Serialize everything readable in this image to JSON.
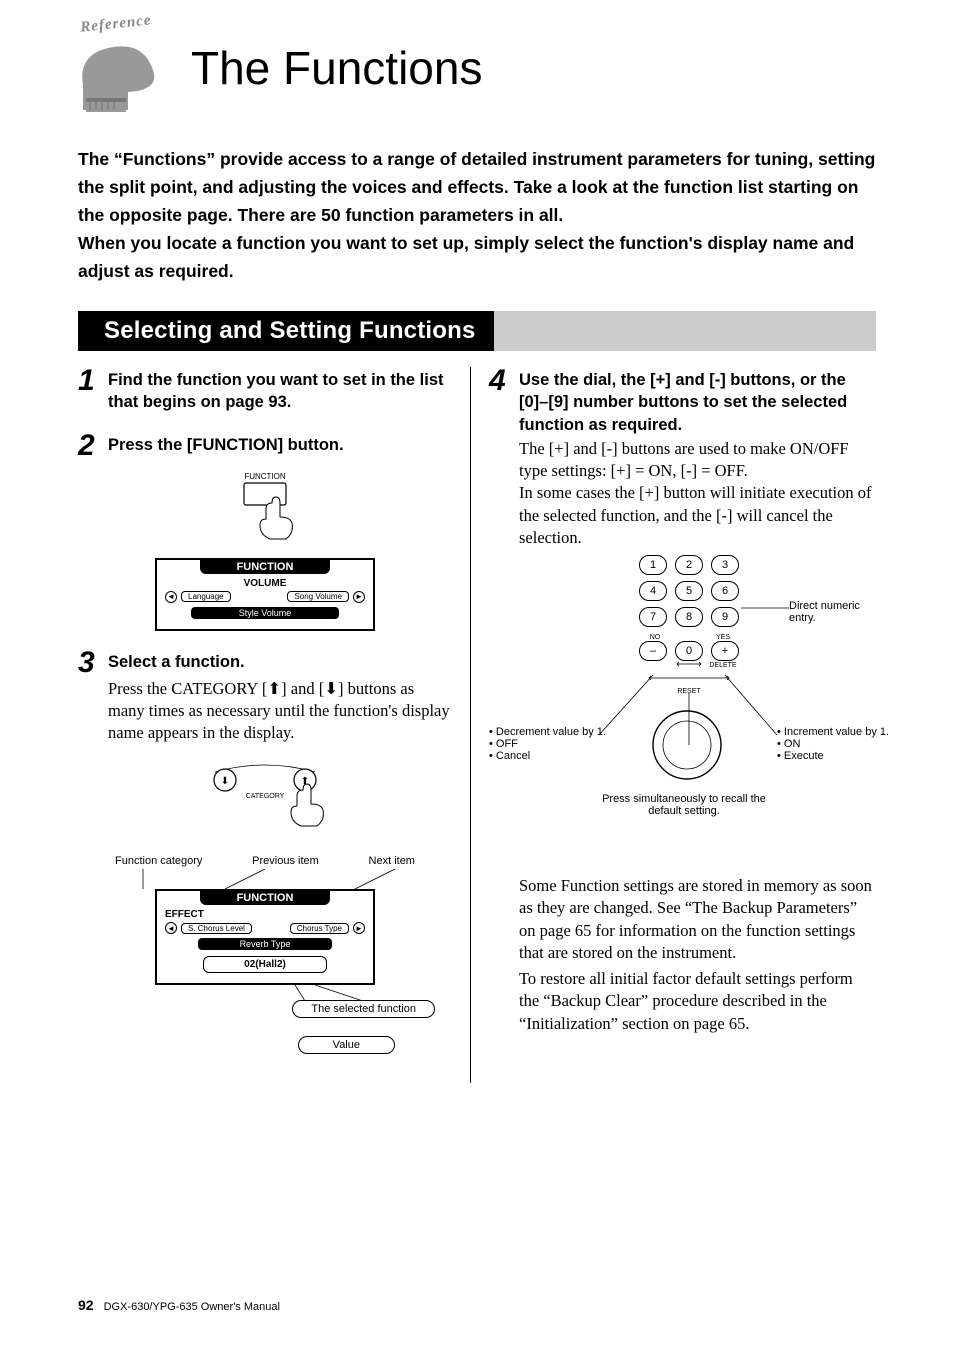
{
  "header": {
    "badge_text": "Reference",
    "page_title": "The Functions"
  },
  "intro": "The “Functions” provide access to a range of detailed instrument parameters for tuning, setting the split point, and adjusting the voices and effects. Take a look at the function list starting on the opposite page. There are 50 function parameters in all.\nWhen you locate a function you want to set up, simply select the function's display name and adjust as required.",
  "section_heading": "Selecting and Setting Functions",
  "steps": {
    "s1": {
      "num": "1",
      "title": "Find the function you want to set in the list that begins on page 93."
    },
    "s2": {
      "num": "2",
      "title": "Press the [FUNCTION] button.",
      "fig_button_label": "FUNCTION",
      "lcd": {
        "title": "FUNCTION",
        "category": "VOLUME",
        "prev": "Language",
        "next": "Song Volume",
        "sel": "Style Volume"
      }
    },
    "s3": {
      "num": "3",
      "title": "Select a function.",
      "body": "Press the CATEGORY [⬆] and [⬇] buttons as many times as necessary until the function's display name appears in the display.",
      "cat_label": "CATEGORY",
      "top_labels": {
        "l": "Function category",
        "m": "Previous item",
        "r": "Next item"
      },
      "lcd": {
        "title": "FUNCTION",
        "category": "EFFECT",
        "prev": "S. Chorus Level",
        "next": "Chorus Type",
        "sel": "Reverb Type",
        "value": "02(Hall2)"
      },
      "bot_labels": {
        "sel": "The selected function",
        "val": "Value"
      }
    },
    "s4": {
      "num": "4",
      "title": "Use the dial, the [+] and [-] buttons, or the [0]–[9] number buttons to set the selected function as required.",
      "body": "The [+] and [-] buttons are used to make ON/OFF type settings: [+] = ON, [-] = OFF.\nIn some cases the [+] button will initiate execution of the selected function, and the [-] will cancel the selection.",
      "numpad": {
        "r1": [
          "1",
          "2",
          "3"
        ],
        "r2": [
          "4",
          "5",
          "6"
        ],
        "r3": [
          "7",
          "8",
          "9"
        ],
        "r4": [
          "–",
          "0",
          "+"
        ],
        "no": "NO",
        "yes": "YES",
        "delete": "DELETE",
        "reset": "RESET"
      },
      "labels": {
        "right": "Direct numeric entry.",
        "left": "• Decrement value by 1.\n• OFF\n• Cancel",
        "rb": "• Increment value by 1.\n• ON\n• Execute",
        "bottom": "Press simultaneously to recall the default setting."
      }
    }
  },
  "notes_p1": "Some Function settings are stored in memory as soon as they are changed. See “The Backup Parameters” on page 65 for information on the function settings that are stored on the instrument.",
  "notes_p2": "To restore all initial factor default settings perform the “Backup Clear” procedure described in the “Initialization” section on page 65.",
  "footer": {
    "page": "92",
    "manual": "DGX-630/YPG-635  Owner's Manual"
  }
}
